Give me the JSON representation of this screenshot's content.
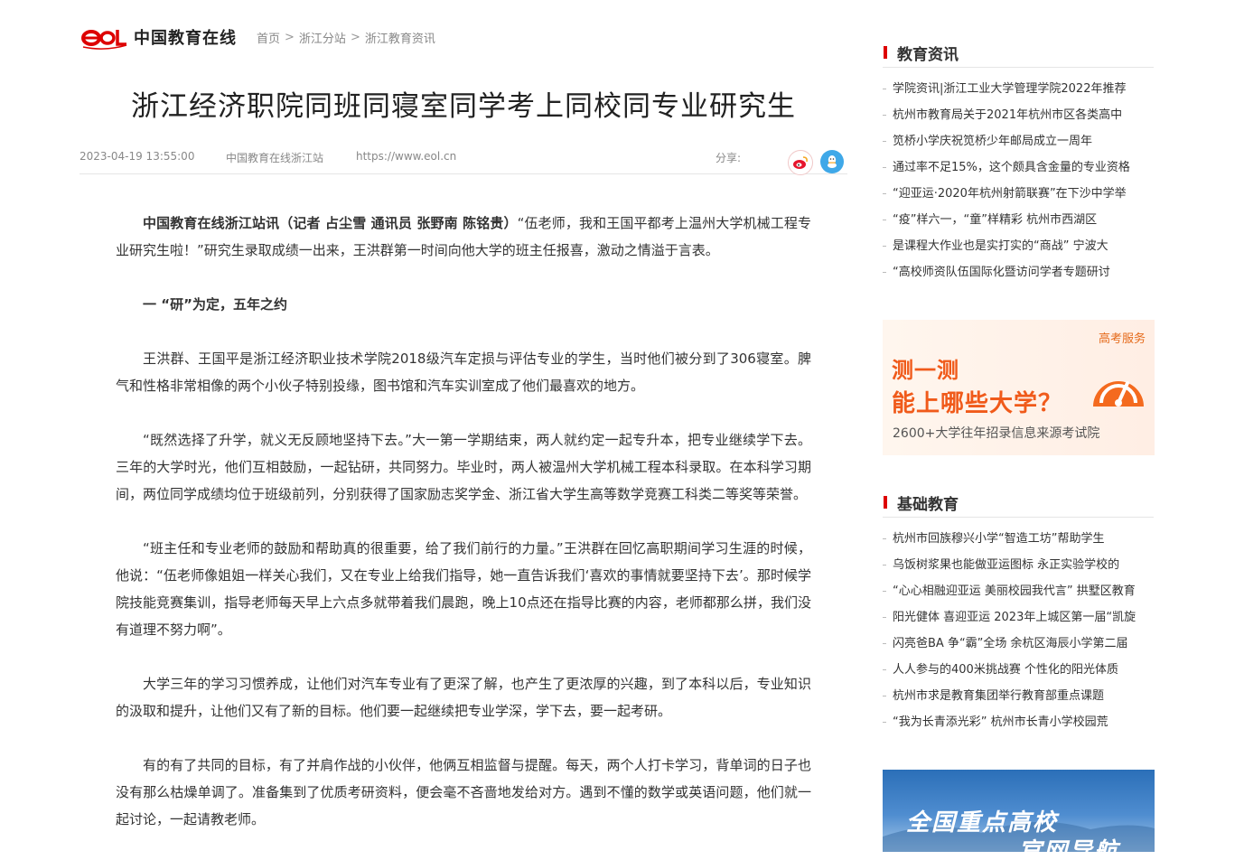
{
  "header": {
    "logo_en": "eol",
    "logo_cn": "中国教育在线",
    "breadcrumb": [
      "首页",
      "浙江分站",
      "浙江教育资讯"
    ],
    "breadcrumb_sep": ">"
  },
  "article": {
    "title": "浙江经济职院同班同寝室同学考上同校同专业研究生",
    "date": "2023-04-19 13:55:00",
    "source": "中国教育在线浙江站",
    "url": "https://www.eol.cn",
    "share_label": "分享:",
    "lead_bold": "中国教育在线浙江站讯（记者 占尘雪 通讯员 张野南 陈铭贵）",
    "lead_rest": "“伍老师，我和王国平都考上温州大学机械工程专业研究生啦！”研究生录取成绩一出来，王洪群第一时间向他大学的班主任报喜，激动之情溢于言表。",
    "section1": "一 “研”为定，五年之约",
    "p2": "王洪群、王国平是浙江经济职业技术学院2018级汽车定损与评估专业的学生，当时他们被分到了306寝室。脾气和性格非常相像的两个小伙子特别投缘，图书馆和汽车实训室成了他们最喜欢的地方。",
    "p3": "“既然选择了升学，就义无反顾地坚持下去。”大一第一学期结束，两人就约定一起专升本，把专业继续学下去。三年的大学时光，他们互相鼓励，一起钻研，共同努力。毕业时，两人被温州大学机械工程本科录取。在本科学习期间，两位同学成绩均位于班级前列，分别获得了国家励志奖学金、浙江省大学生高等数学竞赛工科类二等奖等荣誉。",
    "p4": "“班主任和专业老师的鼓励和帮助真的很重要，给了我们前行的力量。”王洪群在回忆高职期间学习生涯的时候，他说：“伍老师像姐姐一样关心我们，又在专业上给我们指导，她一直告诉我们‘喜欢的事情就要坚持下去’。那时候学院技能竞赛集训，指导老师每天早上六点多就带着我们晨跑，晚上10点还在指导比赛的内容，老师都那么拼，我们没有道理不努力啊”。",
    "p5": "大学三年的学习习惯养成，让他们对汽车专业有了更深了解，也产生了更浓厚的兴趣，到了本科以后，专业知识的汲取和提升，让他们又有了新的目标。他们要一起继续把专业学深，学下去，要一起考研。",
    "p6": "有的有了共同的目标，有了并肩作战的小伙伴，他俩互相监督与提醒。每天，两个人打卡学习，背单词的日子也没有那么枯燥单调了。准备集到了优质考研资料，便会毫不吝啬地发给对方。遇到不懂的数学或英语问题，他们就一起讨论，一起请教老师。"
  },
  "sidebar": {
    "section1_title": "教育资讯",
    "section1_items": [
      "学院资讯|浙江工业大学管理学院2022年推荐",
      "杭州市教育局关于2021年杭州市区各类高中",
      "笕桥小学庆祝笕桥少年邮局成立一周年",
      "通过率不足15%，这个颇具含金量的专业资格",
      "“迎亚运·2020年杭州射箭联赛”在下沙中学举",
      "“疫”样六一，“童”样精彩 杭州市西湖区",
      "是课程大作业也是实打实的“商战” 宁波大",
      "“高校师资队伍国际化暨访问学者专题研讨"
    ],
    "ad1": {
      "badge": "高考服务",
      "line1": "测一测",
      "line2": "能上哪些大学？",
      "line3": "2600+大学往年招录信息来源考试院"
    },
    "section2_title": "基础教育",
    "section2_items": [
      "杭州市回族穆兴小学“智造工坊”帮助学生",
      "乌饭树浆果也能做亚运图标 永正实验学校的",
      "“心心相融迎亚运 美丽校园我代言” 拱墅区教育",
      "阳光健体 喜迎亚运 2023年上城区第一届“凯旋",
      "闪亮爸BA 争“霸”全场 余杭区海辰小学第二届",
      "人人参与的400米挑战赛 个性化的阳光体质",
      "杭州市求是教育集团举行教育部重点课题",
      "“我为长青添光彩” 杭州市长青小学校园荒"
    ],
    "ad2": {
      "line1": "全国重点高校",
      "line2": "官网导航"
    }
  },
  "colors": {
    "accent_red": "#d00000",
    "ad_orange": "#f05a1a",
    "qq_blue": "#3fa8e8"
  }
}
